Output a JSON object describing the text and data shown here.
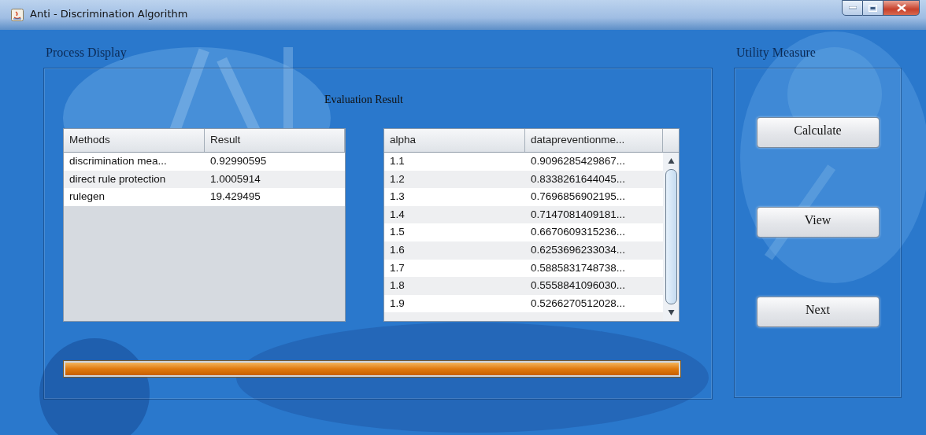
{
  "window": {
    "title": "Anti - Discrimination Algorithm"
  },
  "process_display": {
    "title": "Process Display",
    "heading": "Evaluation Result",
    "methods_table": {
      "columns": [
        "Methods",
        "Result"
      ],
      "rows": [
        [
          "discrimination mea...",
          "0.92990595"
        ],
        [
          "direct rule protection",
          "1.0005914"
        ],
        [
          "rulegen",
          "19.429495"
        ]
      ]
    },
    "alpha_table": {
      "columns": [
        "alpha",
        "datapreventionme..."
      ],
      "rows": [
        [
          "1.1",
          "0.9096285429867..."
        ],
        [
          "1.2",
          "0.8338261644045..."
        ],
        [
          "1.3",
          "0.7696856902195..."
        ],
        [
          "1.4",
          "0.7147081409181..."
        ],
        [
          "1.5",
          "0.6670609315236..."
        ],
        [
          "1.6",
          "0.6253696233034..."
        ],
        [
          "1.7",
          "0.5885831748738..."
        ],
        [
          "1.8",
          "0.5558841096030..."
        ],
        [
          "1.9",
          "0.5266270512028..."
        ]
      ]
    },
    "progress": {
      "level": 1
    }
  },
  "utility_measure": {
    "title": "Utility Measure",
    "buttons": [
      "Calculate",
      "View",
      "Next"
    ]
  }
}
